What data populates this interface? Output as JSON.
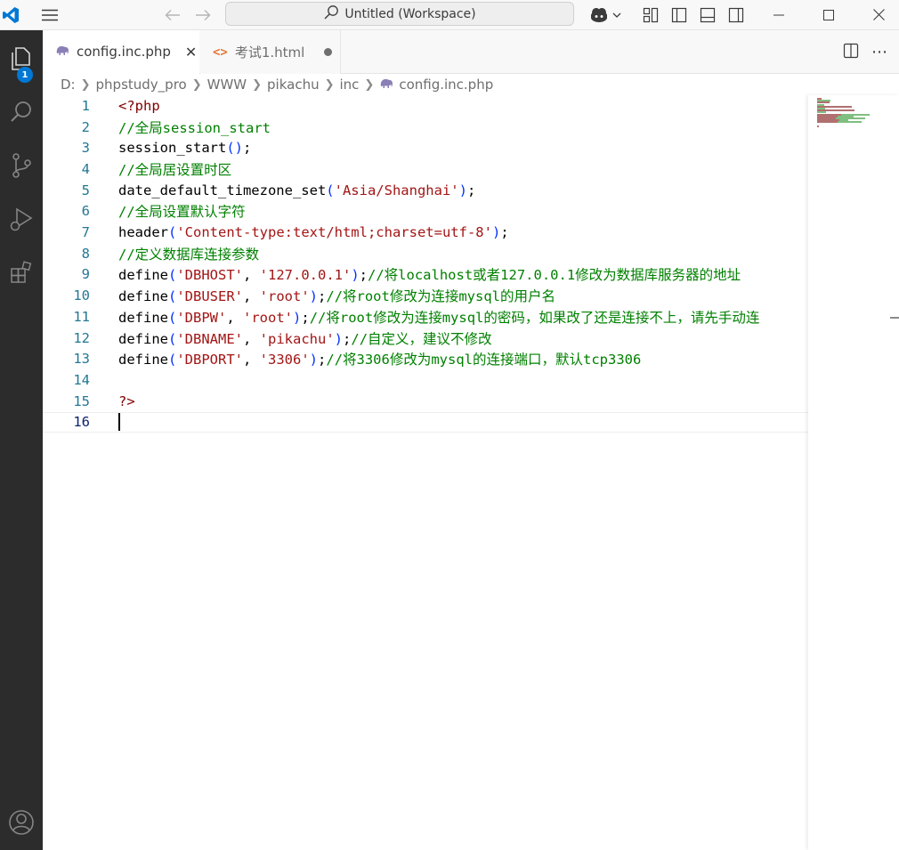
{
  "titlebar": {
    "search_text": "Untitled (Workspace)",
    "icons": [
      "vscode-logo-icon",
      "menu-icon",
      "back-arrow-icon",
      "forward-arrow-icon",
      "search-icon",
      "copilot-icon",
      "chevron-down-icon",
      "customize-layout-icon",
      "toggle-primary-sidebar-icon",
      "toggle-panel-icon",
      "toggle-secondary-sidebar-icon",
      "minimize-icon",
      "maximize-icon",
      "close-icon"
    ]
  },
  "activitybar": {
    "items": [
      "explorer-icon",
      "search-icon",
      "source-control-icon",
      "run-debug-icon",
      "extensions-icon"
    ],
    "explorer_badge": "1",
    "bottom": "accounts-icon"
  },
  "tabs": [
    {
      "label": "config.inc.php",
      "active": true,
      "icon": "php-elephant-icon"
    },
    {
      "label": "考试1.html",
      "active": false,
      "icon": "html-brackets-icon",
      "modified": true
    }
  ],
  "breadcrumb": [
    "D:",
    "phpstudy_pro",
    "WWW",
    "pikachu",
    "inc",
    "config.inc.php"
  ],
  "editor": {
    "lines": [
      {
        "n": "1",
        "text": "<?php"
      },
      {
        "n": "2",
        "text": "//全局session_start"
      },
      {
        "n": "3",
        "text": "session_start();"
      },
      {
        "n": "4",
        "text": "//全局居设置时区"
      },
      {
        "n": "5",
        "text": "date_default_timezone_set('Asia/Shanghai');"
      },
      {
        "n": "6",
        "text": "//全局设置默认字符"
      },
      {
        "n": "7",
        "text": "header('Content-type:text/html;charset=utf-8');"
      },
      {
        "n": "8",
        "text": "//定义数据库连接参数"
      },
      {
        "n": "9",
        "text": "define('DBHOST', '127.0.0.1');//将localhost或者127.0.0.1修改为数据库服务器的地址"
      },
      {
        "n": "10",
        "text": "define('DBUSER', 'root');//将root修改为连接mysql的用户名"
      },
      {
        "n": "11",
        "text": "define('DBPW', 'root');//将root修改为连接mysql的密码，如果改了还是连接不上，请先手动连"
      },
      {
        "n": "12",
        "text": "define('DBNAME', 'pikachu');//自定义，建议不修改"
      },
      {
        "n": "13",
        "text": "define('DBPORT', '3306');//将3306修改为mysql的连接端口，默认tcp3306"
      },
      {
        "n": "14",
        "text": ""
      },
      {
        "n": "15",
        "text": "?>"
      },
      {
        "n": "16",
        "text": ""
      }
    ],
    "current_line": "16"
  },
  "colors": {
    "activitybar_bg": "#2c2c2c",
    "accent": "#0078d4",
    "comment": "#008000",
    "string": "#a31515",
    "keyword": "#800000",
    "line_number": "#237893"
  }
}
